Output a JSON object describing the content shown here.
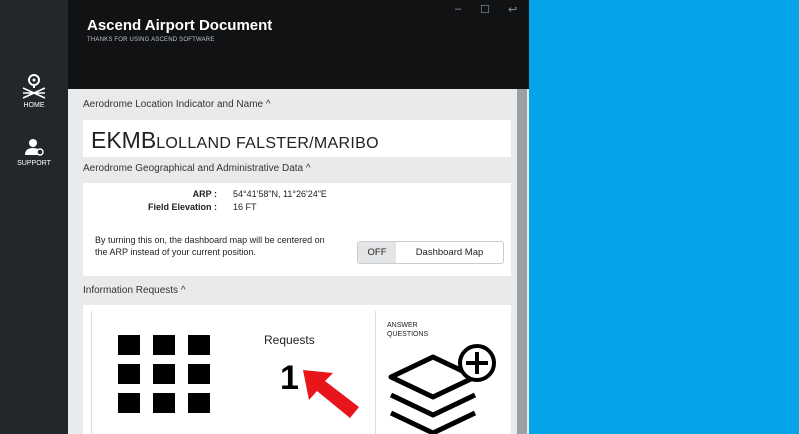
{
  "window": {
    "title": "Ascend Airport Document",
    "subtitle": "THANKS FOR USING ASCEND SOFTWARE",
    "controls": {
      "minimize": "–",
      "maximize": "☐",
      "restore": "↩"
    }
  },
  "sidebar": {
    "items": [
      {
        "label": "HOME",
        "icon": "home-icon"
      },
      {
        "label": "SUPPORT",
        "icon": "support-icon"
      }
    ]
  },
  "sections": {
    "location": {
      "header": "Aerodrome Location Indicator and Name ^",
      "icao": "EKMB",
      "name": "LOLLAND FALSTER/MARIBO"
    },
    "geo": {
      "header": "Aerodrome Geographical and Administrative Data ^",
      "arp_label": "ARP :",
      "arp_value": "54°41'58\"N, 11°26'24\"E",
      "elev_label": "Field Elevation :",
      "elev_value": "16 FT",
      "info": "By turning this on, the dashboard map will be centered on the ARP instead of your current position.",
      "toggle_off": "OFF",
      "toggle_label": "Dashboard Map"
    },
    "requests": {
      "header": "Information Requests ^",
      "label": "Requests",
      "count": "1",
      "answer_label_1": "ANSWER",
      "answer_label_2": "QUESTIONS"
    }
  },
  "colors": {
    "accent_bg": "#03a4e8",
    "arrow": "#e8161a",
    "sidebar": "#23272b",
    "header": "#111214"
  }
}
